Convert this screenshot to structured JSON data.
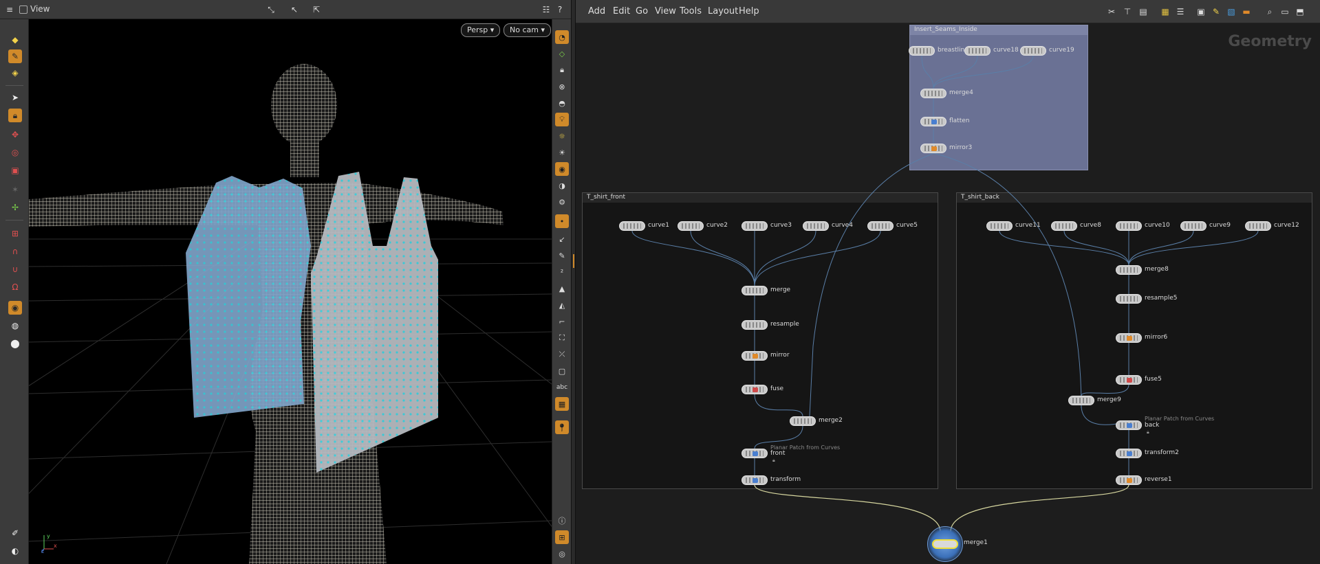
{
  "viewport": {
    "title": "View",
    "help_glyph": "?",
    "camera_mode": "Persp",
    "camera": "No cam",
    "right_strip_text": "abc",
    "axes": {
      "y": "y",
      "x": "x",
      "z": "z"
    }
  },
  "network": {
    "menus": [
      "Add",
      "Edit",
      "Go",
      "View",
      "Tools",
      "Layout",
      "Help"
    ],
    "context_label": "Geometry",
    "boxes": {
      "insert_seams": "Insert_Seams_Inside",
      "front": "T_shirt_front",
      "back": "T_shirt_back"
    },
    "nodes": {
      "breastline": "breastline",
      "curve18": "curve18",
      "curve19": "curve19",
      "merge4": "merge4",
      "flatten": "flatten",
      "mirror3": "mirror3",
      "curve1": "curve1",
      "curve2": "curve2",
      "curve3": "curve3",
      "curve4": "curve4",
      "curve5": "curve5",
      "merge": "merge",
      "resample": "resample",
      "mirror": "mirror",
      "fuse": "fuse",
      "merge2": "merge2",
      "front": "front",
      "transform": "transform",
      "curve11": "curve11",
      "curve8": "curve8",
      "curve10": "curve10",
      "curve9": "curve9",
      "curve12": "curve12",
      "merge8": "merge8",
      "resample5": "resample5",
      "mirror6": "mirror6",
      "fuse5": "fuse5",
      "merge9": "merge9",
      "back": "back",
      "transform2": "transform2",
      "reverse1": "reverse1",
      "merge1": "merge1"
    },
    "comments": {
      "front": "Planar Patch from Curves",
      "back": "Planar Patch from Curves"
    }
  },
  "colors": {
    "accent": "#d08a2a",
    "mesh_points": "#3fd2e0",
    "mesh_fill": "#7fa3c8",
    "body_wire": "#cfcabb",
    "subnet_box": "#6a7194",
    "wire": "#5a7fa8",
    "output_wire": "#d8d8a0"
  }
}
